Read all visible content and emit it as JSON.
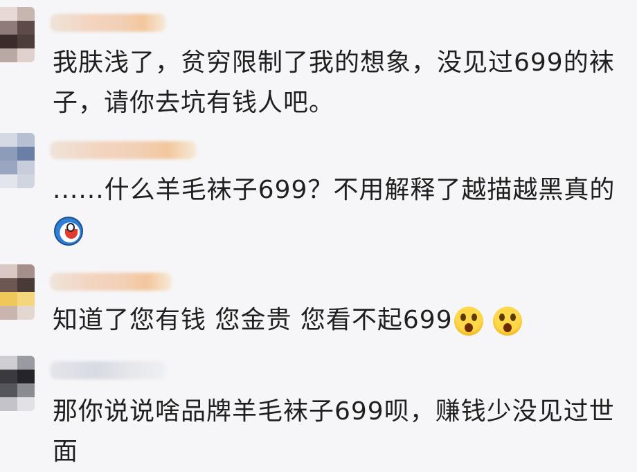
{
  "comments": [
    {
      "text": "我肤浅了，贫穷限制了我的想象，没见过699的袜子，请你去坑有钱人吧。",
      "emojis": []
    },
    {
      "text": "......什么羊毛袜子699？不用解释了越描越黑真的",
      "emojis": [
        "doraemon-emoji"
      ]
    },
    {
      "text": "知道了您有钱 您金贵 您看不起699",
      "emojis": [
        "shocked-face-emoji",
        "shocked-face-emoji"
      ]
    },
    {
      "text": "那你说说啥品牌羊毛袜子699呗，赚钱少没见过世面",
      "emojis": []
    }
  ]
}
